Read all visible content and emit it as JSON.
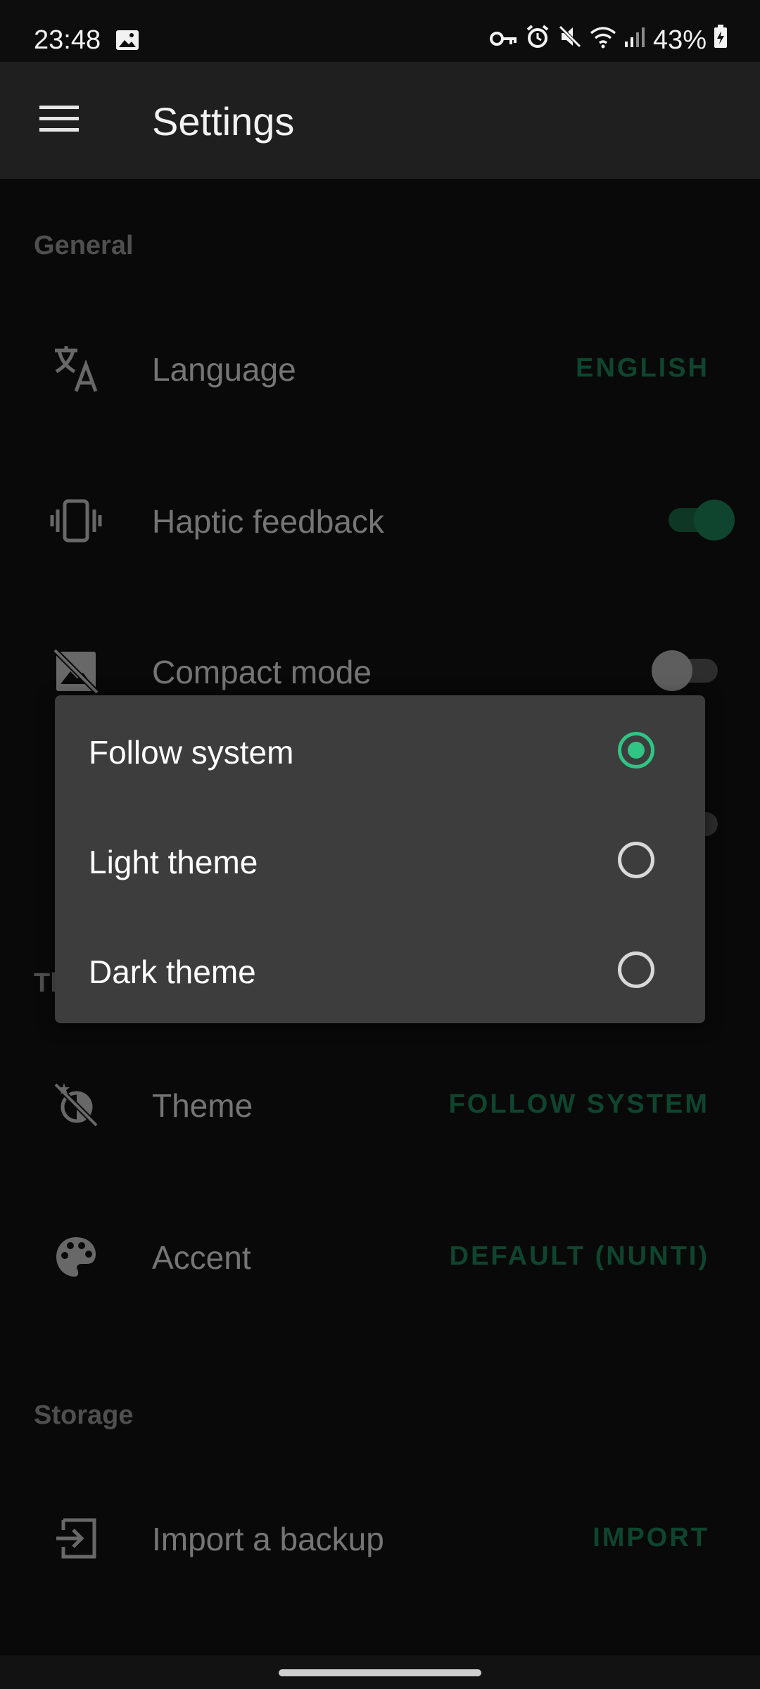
{
  "status": {
    "time": "23:48",
    "battery": "43%",
    "icons": [
      "image-icon",
      "vpn-key-icon",
      "alarm-icon",
      "mute-icon",
      "wifi-icon",
      "signal-icon",
      "battery-charging-icon"
    ]
  },
  "app_bar": {
    "title": "Settings",
    "menu_icon": "hamburger-menu-icon"
  },
  "colors": {
    "accent": "#30c485",
    "accent_dim": "#1f8a5d",
    "surface": "#121212",
    "dialog": "#3d3d3d"
  },
  "sections": {
    "general": "General",
    "theme_partial": "Th",
    "storage": "Storage"
  },
  "rows": {
    "language": {
      "label": "Language",
      "value": "ENGLISH",
      "icon": "translate-icon"
    },
    "haptic": {
      "label": "Haptic feedback",
      "on": true,
      "icon": "vibration-icon"
    },
    "compact": {
      "label": "Compact mode",
      "on": false,
      "icon": "hide-image-icon"
    },
    "theme": {
      "label": "Theme",
      "value": "FOLLOW SYSTEM",
      "icon": "theme-icon"
    },
    "accent": {
      "label": "Accent",
      "value": "DEFAULT (NUNTI)",
      "icon": "palette-icon"
    },
    "import": {
      "label": "Import a backup",
      "value": "IMPORT",
      "icon": "import-icon"
    }
  },
  "dialog": {
    "options": [
      {
        "label": "Follow system",
        "selected": true
      },
      {
        "label": "Light theme",
        "selected": false
      },
      {
        "label": "Dark theme",
        "selected": false
      }
    ]
  }
}
